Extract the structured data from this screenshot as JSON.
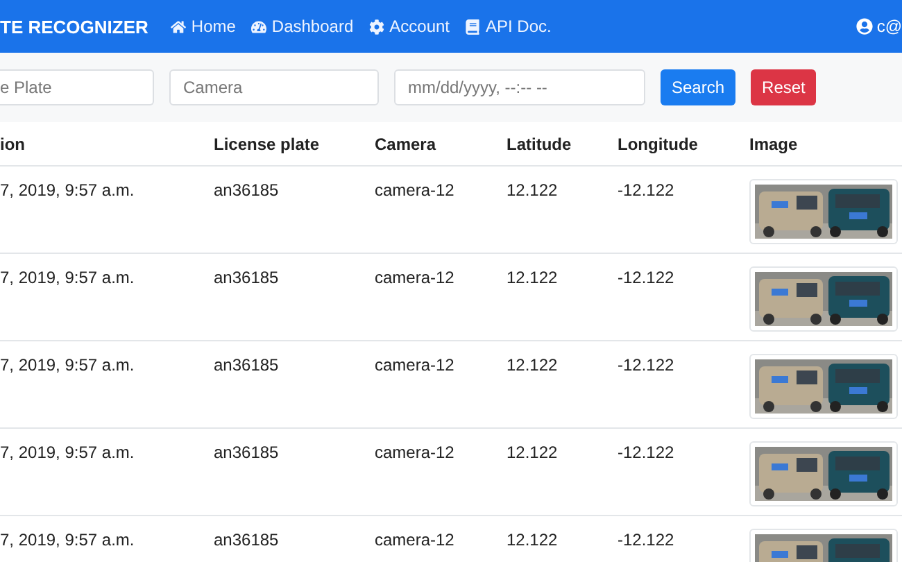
{
  "navbar": {
    "brand": "TE RECOGNIZER",
    "links": [
      {
        "kind": "home",
        "label": "Home"
      },
      {
        "kind": "dashboard",
        "label": "Dashboard"
      },
      {
        "kind": "account",
        "label": "Account"
      },
      {
        "kind": "docs",
        "label": "API Doc."
      }
    ],
    "user": "c@"
  },
  "filters": {
    "plate": {
      "placeholder": "e Plate"
    },
    "camera": {
      "placeholder": "Camera"
    },
    "date": {
      "placeholder": "mm/dd/yyyy, --:-- --"
    },
    "buttons": [
      {
        "kind": "primary",
        "label": "Search"
      },
      {
        "kind": "danger",
        "label": "Reset"
      }
    ]
  },
  "table": {
    "columns": [
      "ion",
      "License plate",
      "Camera",
      "Latitude",
      "Longitude",
      "Image"
    ],
    "rows": [
      {
        "time": "7, 2019, 9:57 a.m.",
        "plate": "an36185",
        "camera": "camera-12",
        "latitude": "12.122",
        "longitude": "-12.122"
      },
      {
        "time": "7, 2019, 9:57 a.m.",
        "plate": "an36185",
        "camera": "camera-12",
        "latitude": "12.122",
        "longitude": "-12.122"
      },
      {
        "time": "7, 2019, 9:57 a.m.",
        "plate": "an36185",
        "camera": "camera-12",
        "latitude": "12.122",
        "longitude": "-12.122"
      },
      {
        "time": "7, 2019, 9:57 a.m.",
        "plate": "an36185",
        "camera": "camera-12",
        "latitude": "12.122",
        "longitude": "-12.122"
      },
      {
        "time": "7, 2019, 9:57 a.m.",
        "plate": "an36185",
        "camera": "camera-12",
        "latitude": "12.122",
        "longitude": "-12.122"
      }
    ]
  }
}
